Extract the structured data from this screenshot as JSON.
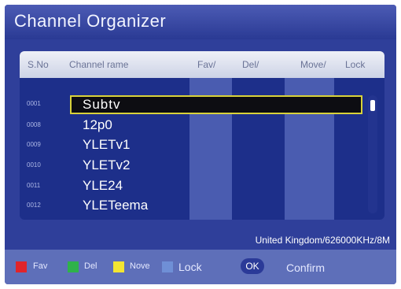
{
  "title": "Channel Organizer",
  "columns": {
    "sno": "S.No",
    "channel_name": "Channel rame",
    "fav": "Fav/",
    "del": "Del/",
    "move": "Move/",
    "lock": "Lock"
  },
  "rows": [
    {
      "sno": "0001",
      "name": "Subtv",
      "selected": true
    },
    {
      "sno": "0008",
      "name": "12p0"
    },
    {
      "sno": "0009",
      "name": "YLETv1"
    },
    {
      "sno": "0010",
      "name": "YLETv2"
    },
    {
      "sno": "0011",
      "name": "YLE24"
    },
    {
      "sno": "0012",
      "name": "YLETeema"
    }
  ],
  "region_info": "United Kingdom/626000KHz/8M",
  "footer": {
    "keys": [
      {
        "label": "Fav",
        "color": "#e0242b",
        "icon": "red-key-icon"
      },
      {
        "label": "Del",
        "color": "#2fb24a",
        "icon": "green-key-icon"
      },
      {
        "label": "Nove",
        "color": "#f3e532",
        "icon": "yellow-key-icon"
      },
      {
        "label": "Lock",
        "color": "#6f8fd6",
        "icon": "blue-key-icon"
      }
    ],
    "ok_label": "OK",
    "confirm_label": "Confirm"
  }
}
